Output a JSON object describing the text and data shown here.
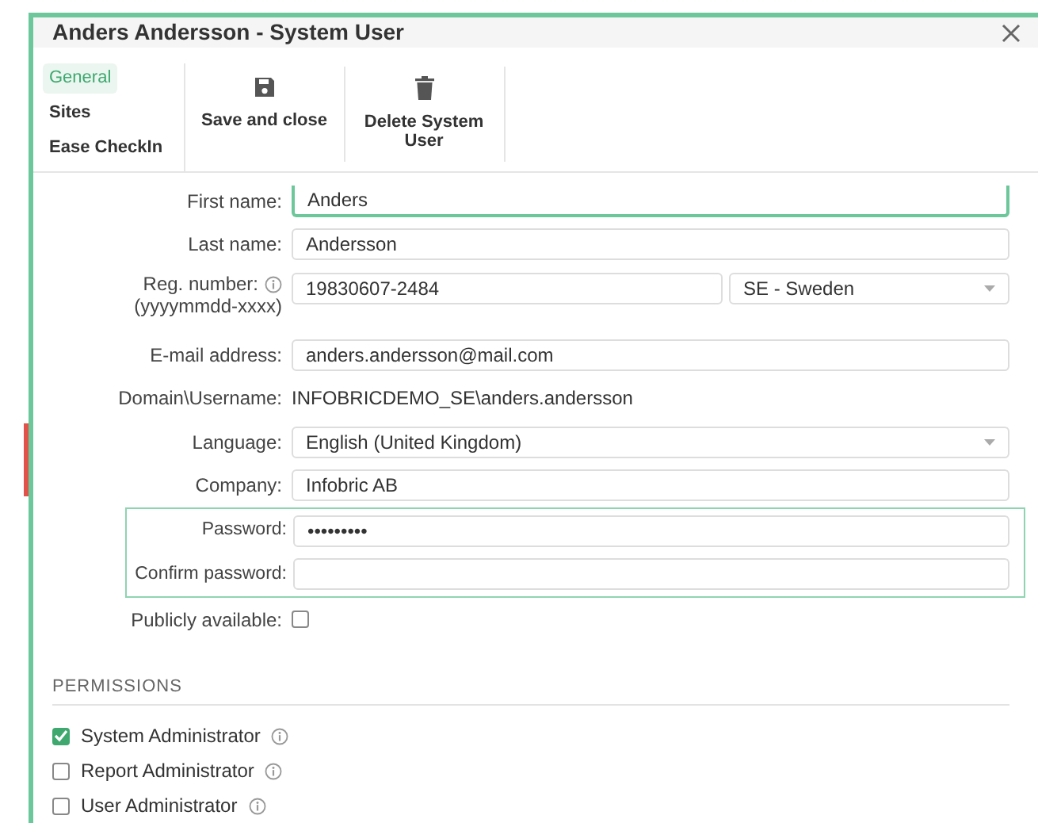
{
  "window": {
    "title": "Anders Andersson - System User"
  },
  "tabs": [
    {
      "label": "General",
      "selected": true
    },
    {
      "label": "Sites",
      "selected": false
    },
    {
      "label": "Ease CheckIn",
      "selected": false
    }
  ],
  "toolbar": [
    {
      "label": "Save and close"
    },
    {
      "label": "Delete System User"
    }
  ],
  "form": [
    {
      "kind": "text",
      "label": "First name:",
      "value": "Anders",
      "focused": true
    },
    {
      "kind": "text",
      "label": "Last name:",
      "value": "Andersson",
      "focused": false
    },
    {
      "kind": "text-select",
      "label": "Reg. number:",
      "hint": "(yyyymmdd-xxxx)",
      "info": true,
      "value": "19830607-2484",
      "option": "SE - Sweden"
    },
    {
      "kind": "text",
      "label": "E-mail address:",
      "value": "anders.andersson@mail.com",
      "focused": false
    },
    {
      "kind": "static",
      "label": "Domain\\Username:",
      "value": "INFOBRICDEMO_SE\\anders.andersson"
    },
    {
      "kind": "select",
      "label": "Language:",
      "value": "English (United Kingdom)"
    },
    {
      "kind": "text",
      "label": "Company:",
      "value": "Infobric AB",
      "focused": false
    },
    {
      "kind": "group",
      "rows": [
        {
          "kind": "text",
          "label": "Password:",
          "value": "•••••••••",
          "focused": false
        },
        {
          "kind": "text",
          "label": "Confirm password:",
          "focused": false
        }
      ]
    },
    {
      "kind": "checkbox",
      "label": "Publicly available:",
      "checked": false
    }
  ],
  "permissions": {
    "title": "PERMISSIONS",
    "items": [
      {
        "label": "System Administrator",
        "checked": true
      },
      {
        "label": "Report Administrator",
        "checked": false
      },
      {
        "label": "User Administrator",
        "checked": false
      }
    ]
  }
}
